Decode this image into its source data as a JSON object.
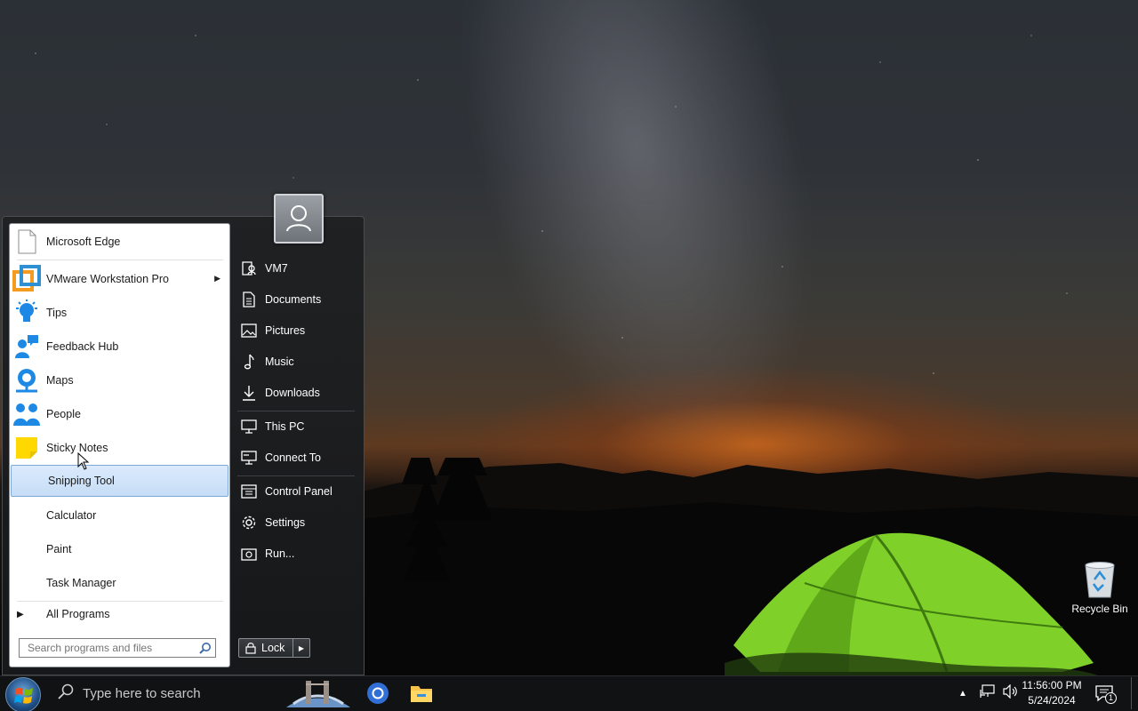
{
  "start_menu": {
    "programs": [
      {
        "label": "Microsoft Edge",
        "icon": "blank-document-icon"
      },
      {
        "label": "VMware Workstation Pro",
        "icon": "vmware-icon",
        "submenu": true
      },
      {
        "label": "Tips",
        "icon": "lightbulb-icon"
      },
      {
        "label": "Feedback Hub",
        "icon": "feedback-hub-icon"
      },
      {
        "label": "Maps",
        "icon": "maps-icon"
      },
      {
        "label": "People",
        "icon": "people-icon"
      },
      {
        "label": "Sticky Notes",
        "icon": "sticky-notes-icon"
      },
      {
        "label": "Snipping Tool",
        "icon": "",
        "hovered": true
      },
      {
        "label": "Calculator",
        "icon": ""
      },
      {
        "label": "Paint",
        "icon": ""
      },
      {
        "label": "Task Manager",
        "icon": ""
      }
    ],
    "all_programs": "All Programs",
    "search_placeholder": "Search programs and files",
    "places": [
      {
        "label": "VM7",
        "icon": "user-folder-icon"
      },
      {
        "label": "Documents",
        "icon": "documents-icon"
      },
      {
        "label": "Pictures",
        "icon": "pictures-icon"
      },
      {
        "label": "Music",
        "icon": "music-icon"
      },
      {
        "label": "Downloads",
        "icon": "downloads-icon"
      },
      {
        "label": "This PC",
        "icon": "computer-icon"
      },
      {
        "label": "Connect To",
        "icon": "connect-icon"
      },
      {
        "label": "Control Panel",
        "icon": "control-panel-icon"
      },
      {
        "label": "Settings",
        "icon": "gear-icon"
      },
      {
        "label": "Run...",
        "icon": "run-icon"
      }
    ],
    "lock_label": "Lock"
  },
  "desktop": {
    "recycle_bin_label": "Recycle Bin"
  },
  "taskbar": {
    "search_placeholder": "Type here to search",
    "time": "11:56:00 PM",
    "date": "5/24/2024",
    "notification_count": "1"
  },
  "colors": {
    "menu_hover_bg": "#c6ddf6",
    "menu_dark_bg": "#1e2022",
    "taskbar_bg": "#101214"
  }
}
